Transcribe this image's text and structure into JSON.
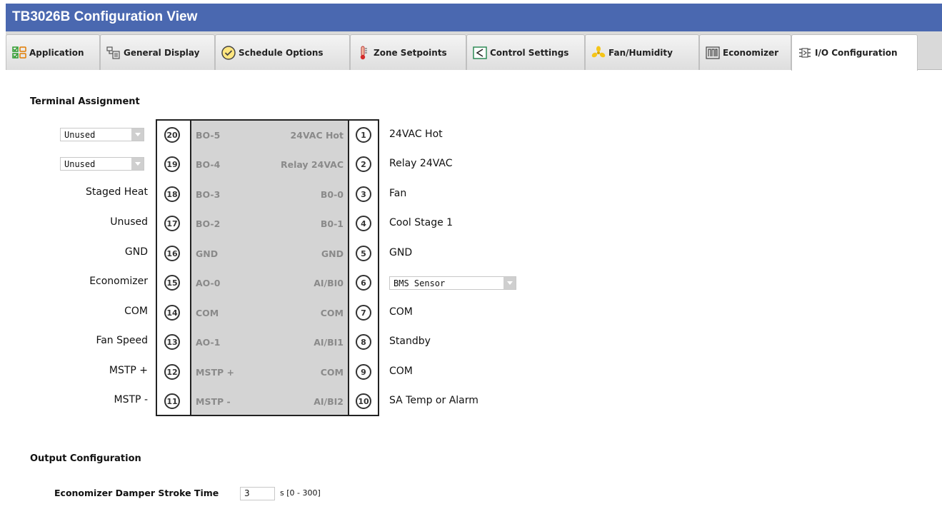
{
  "window": {
    "title": "TB3026B Configuration View"
  },
  "tabs": [
    {
      "label": "Application",
      "icon": "application-icon"
    },
    {
      "label": "General Display",
      "icon": "display-icon"
    },
    {
      "label": "Schedule Options",
      "icon": "schedule-check-icon"
    },
    {
      "label": "Zone Setpoints",
      "icon": "thermometer-icon"
    },
    {
      "label": "Control Settings",
      "icon": "control-settings-icon"
    },
    {
      "label": "Fan/Humidity",
      "icon": "fan-icon"
    },
    {
      "label": "Economizer",
      "icon": "economizer-icon"
    },
    {
      "label": "I/O Configuration",
      "icon": "io-config-icon",
      "active": true
    }
  ],
  "terminal_assignment": {
    "title": "Terminal Assignment",
    "rows": [
      {
        "left_value": "Unused",
        "left_is_dropdown": true,
        "left_num": "20",
        "left_block": "BO-5",
        "right_block": "24VAC Hot",
        "right_num": "1",
        "right_value": "24VAC Hot"
      },
      {
        "left_value": "Unused",
        "left_is_dropdown": true,
        "left_num": "19",
        "left_block": "BO-4",
        "right_block": "Relay 24VAC",
        "right_num": "2",
        "right_value": "Relay 24VAC"
      },
      {
        "left_value": "Staged Heat",
        "left_num": "18",
        "left_block": "BO-3",
        "right_block": "B0-0",
        "right_num": "3",
        "right_value": "Fan"
      },
      {
        "left_value": "Unused",
        "left_num": "17",
        "left_block": "BO-2",
        "right_block": "B0-1",
        "right_num": "4",
        "right_value": "Cool Stage 1"
      },
      {
        "left_value": "GND",
        "left_num": "16",
        "left_block": "GND",
        "right_block": "GND",
        "right_num": "5",
        "right_value": "GND"
      },
      {
        "left_value": "Economizer",
        "left_num": "15",
        "left_block": "AO-0",
        "right_block": "AI/BI0",
        "right_num": "6",
        "right_value": "BMS Sensor",
        "right_is_dropdown": true
      },
      {
        "left_value": "COM",
        "left_num": "14",
        "left_block": "COM",
        "right_block": "COM",
        "right_num": "7",
        "right_value": "COM"
      },
      {
        "left_value": "Fan Speed",
        "left_num": "13",
        "left_block": "AO-1",
        "right_block": "AI/BI1",
        "right_num": "8",
        "right_value": "Standby"
      },
      {
        "left_value": "MSTP +",
        "left_num": "12",
        "left_block": "MSTP +",
        "right_block": "COM",
        "right_num": "9",
        "right_value": "COM"
      },
      {
        "left_value": "MSTP -",
        "left_num": "11",
        "left_block": "MSTP -",
        "right_block": "AI/BI2",
        "right_num": "10",
        "right_value": "SA Temp or Alarm"
      }
    ]
  },
  "output_configuration": {
    "title": "Output Configuration",
    "damper_stroke_label": "Economizer Damper Stroke Time",
    "damper_stroke_value": "3",
    "damper_stroke_unit": "s [0 - 300]"
  },
  "colors": {
    "title_bar": "#4a68b0",
    "block_fill": "#d4d4d4"
  }
}
